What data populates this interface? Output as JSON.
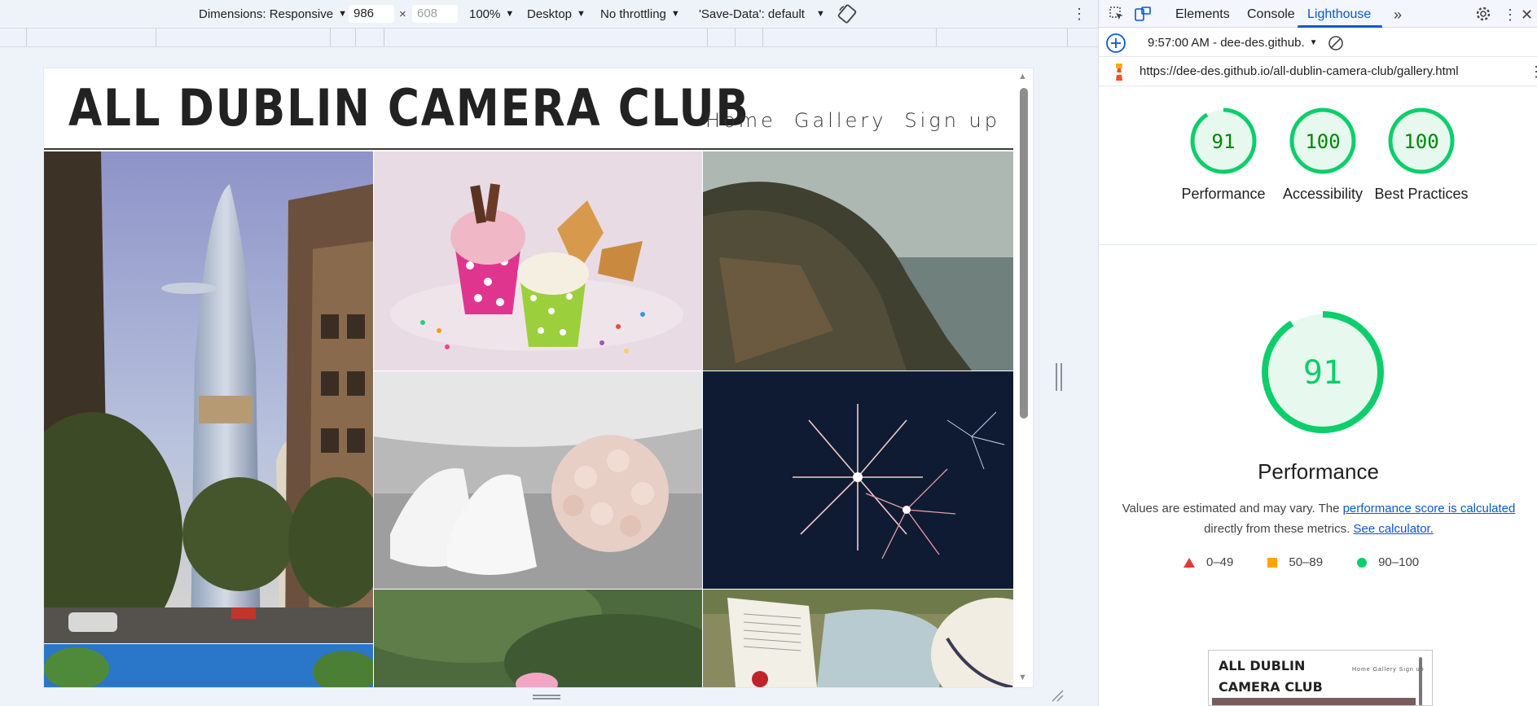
{
  "device_toolbar": {
    "dimensions_label": "Dimensions: Responsive",
    "width_value": "986",
    "height_value": "608",
    "zoom": "100%",
    "device_type": "Desktop",
    "throttling": "No throttling",
    "save_data": "'Save-Data': default"
  },
  "site": {
    "title": "ALL DUBLIN CAMERA CLUB",
    "nav": [
      "Home",
      "Gallery",
      "Sign up"
    ],
    "photos": [
      "city-tower-photo",
      "ice-cream-photo",
      "coastal-cliffs-photo",
      "wedding-shoes-bouquet-photo",
      "fireworks-photo",
      "green-blur-photo",
      "book-and-hat-photo",
      "blue-sky-trees-photo"
    ]
  },
  "devtools": {
    "tabs": [
      "Elements",
      "Console",
      "Lighthouse"
    ],
    "active_tab": "Lighthouse",
    "report_selector": "9:57:00 AM - dee-des.github.",
    "url": "https://dee-des.github.io/all-dublin-camera-club/gallery.html",
    "scores": [
      {
        "label": "Performance",
        "score": "91",
        "value": 91
      },
      {
        "label": "Accessibility",
        "score": "100",
        "value": 100
      },
      {
        "label": "Best Practices",
        "score": "100",
        "value": 100
      }
    ],
    "main_score": {
      "label": "Performance",
      "score": "91",
      "value": 91
    },
    "desc_prefix": "Values are estimated and may vary. The ",
    "desc_link": "performance score is calculated",
    "desc_suffix": "directly from these metrics.",
    "desc_calc_link": "See calculator.",
    "legend": [
      {
        "range": "0–49",
        "color": "#e53935"
      },
      {
        "range": "50–89",
        "color": "#ffa400"
      },
      {
        "range": "90–100",
        "color": "#0cce6b"
      }
    ],
    "thumbnail": {
      "title": "ALL DUBLIN CAMERA CLUB",
      "nav": "Home  Gallery  Sign up"
    }
  },
  "colors": {
    "pass_green": "#0cce6b",
    "pass_fill": "#e7f8ee",
    "pass_text": "#008800",
    "accent_blue": "#0b57d0"
  }
}
